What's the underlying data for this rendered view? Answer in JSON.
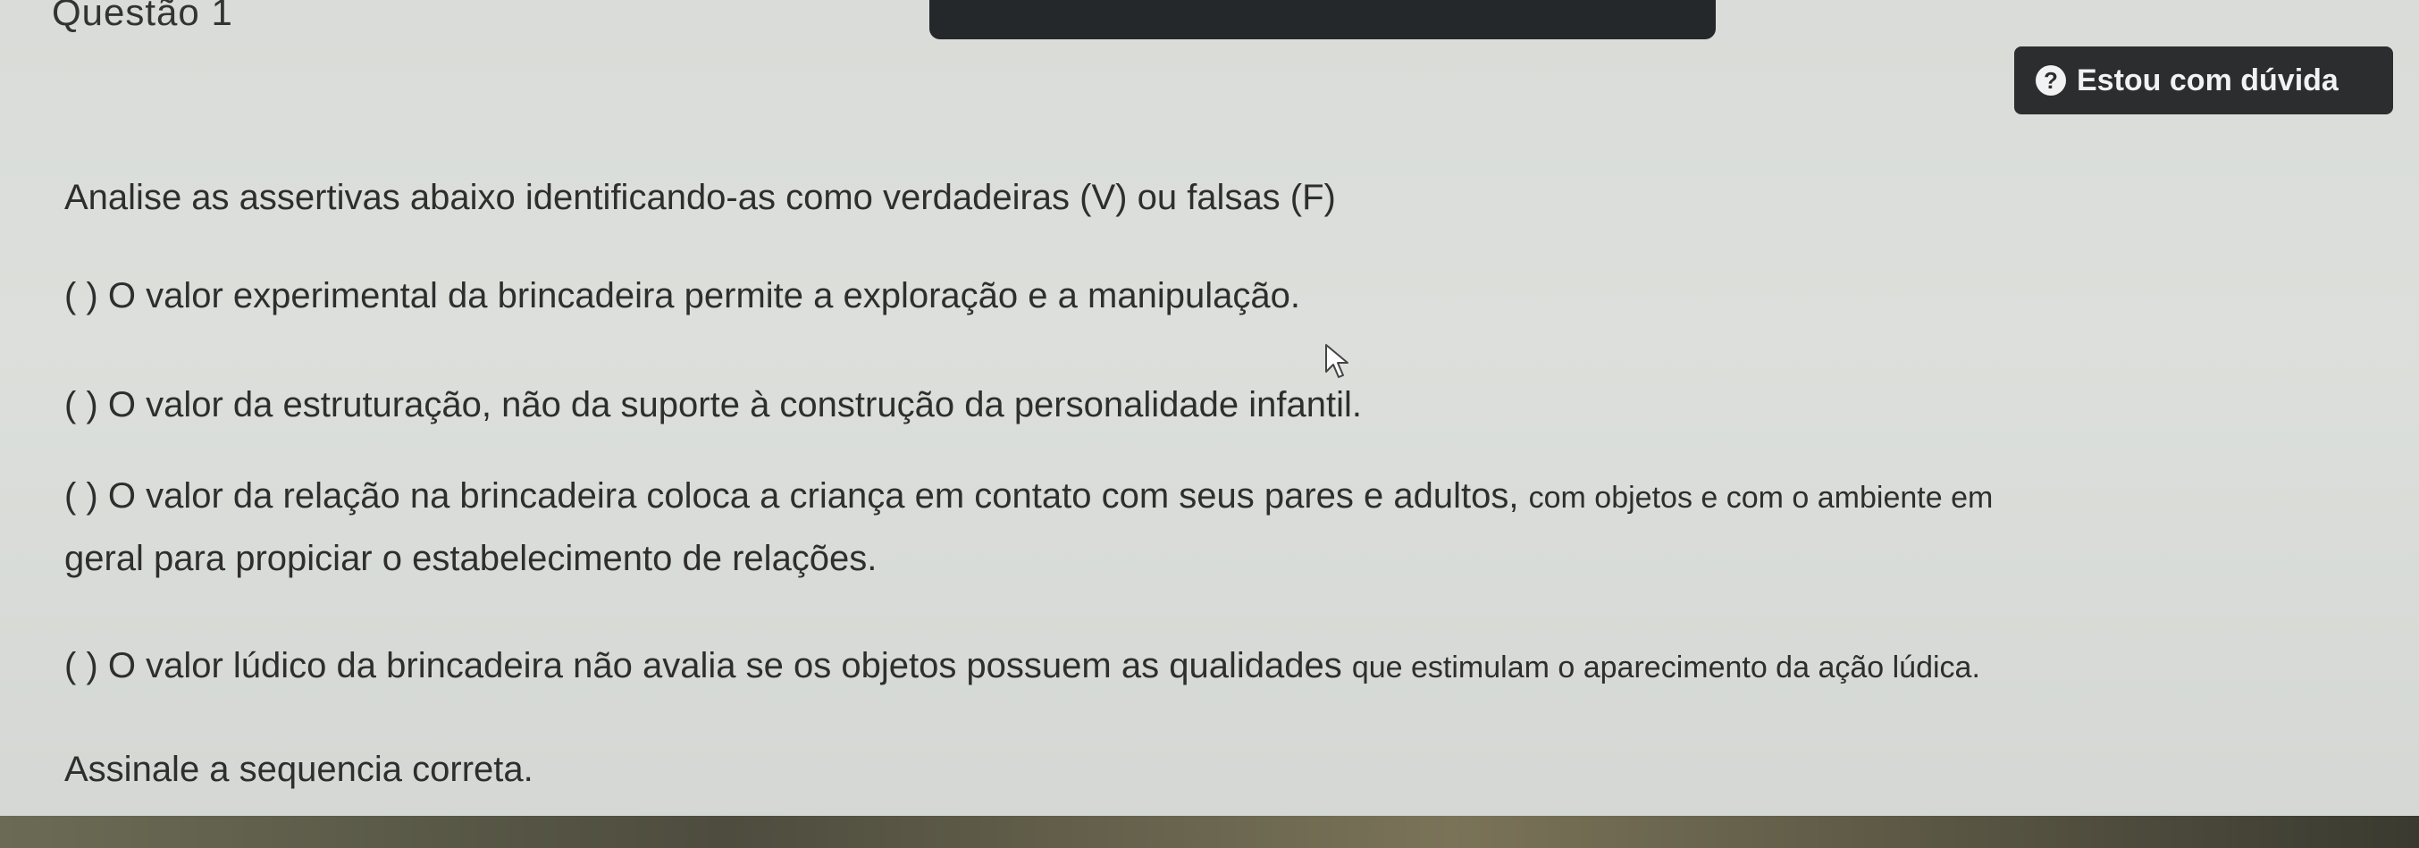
{
  "header": {
    "question_title": "Questão 1",
    "help_button_label": "Estou com dúvida",
    "help_icon": "question-circle-icon"
  },
  "question": {
    "prompt": "Analise as assertivas abaixo identificando-as como verdadeiras (V) ou falsas (F)",
    "statements": [
      {
        "line1": "( ) O valor experimental da brincadeira permite a exploração e a manipulação."
      },
      {
        "line1": "( ) O valor da estruturação, não da suporte à construção da personalidade infantil."
      },
      {
        "line1_main": "( ) O valor da relação na brincadeira coloca a criança em contato com seus pares e adultos, ",
        "line1_small": "com objetos e com o ambiente em",
        "line2": "geral para propiciar o estabelecimento de relações."
      },
      {
        "line1_main": "( ) O valor lúdico da brincadeira não avalia se os objetos possuem as qualidades ",
        "line1_small": "que estimulam o aparecimento da ação lúdica."
      }
    ],
    "instruction": "Assinale a sequencia correta."
  },
  "colors": {
    "background": "#dadcd8",
    "top_bar": "#24282b",
    "help_button": "#2b2d2f",
    "text": "#2e2e2e"
  }
}
